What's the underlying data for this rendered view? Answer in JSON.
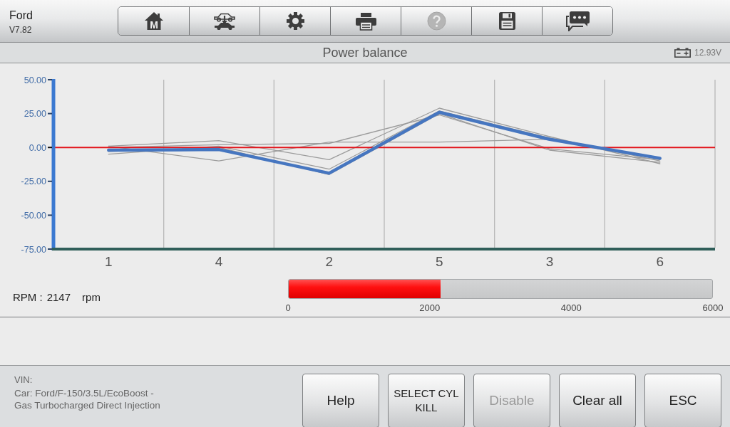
{
  "header": {
    "title": "Ford",
    "version": "V7.82"
  },
  "toolbar": [
    {
      "kind": "home",
      "letter": "M",
      "disabled": false
    },
    {
      "kind": "vehicle",
      "disabled": false
    },
    {
      "kind": "settings",
      "disabled": false
    },
    {
      "kind": "print",
      "disabled": false
    },
    {
      "kind": "help",
      "disabled": true
    },
    {
      "kind": "save",
      "disabled": false
    },
    {
      "kind": "messages",
      "disabled": false
    }
  ],
  "title_bar": {
    "title": "Power balance",
    "battery_voltage": "12.93V"
  },
  "graph": {
    "chart_data": {
      "type": "line",
      "categories": [
        "1",
        "4",
        "2",
        "5",
        "3",
        "6"
      ],
      "ylim": [
        -75,
        50
      ],
      "yticks": [
        {
          "value": 50,
          "label": "50.00"
        },
        {
          "value": 25,
          "label": "25.00"
        },
        {
          "value": 0,
          "label": "0.00"
        },
        {
          "value": -25,
          "label": "-25.00"
        },
        {
          "value": -50,
          "label": "-50.00"
        },
        {
          "value": -75,
          "label": "-75.00"
        }
      ],
      "series": [
        {
          "color": "#9c9c9c",
          "values": [
            -5,
            1,
            -16,
            27,
            7,
            -10
          ]
        },
        {
          "color": "#9c9c9c",
          "values": [
            1,
            5,
            -9,
            29,
            8,
            -12
          ]
        },
        {
          "color": "#9c9c9c",
          "values": [
            1,
            -10,
            4,
            4,
            6,
            -8
          ]
        },
        {
          "color": "#9c9c9c",
          "values": [
            0,
            2,
            3,
            24,
            -1,
            -9
          ]
        },
        {
          "color": "#9c9c9c",
          "values": [
            -3,
            0,
            -20,
            25,
            -2,
            -11
          ]
        },
        {
          "color": "#4676c0",
          "values": [
            -2,
            -1.5,
            -19,
            26,
            6,
            -8
          ]
        }
      ],
      "ref_lines": [
        {
          "axis": "y",
          "value": 0,
          "color": "#e3141b"
        }
      ]
    }
  },
  "rpm": {
    "label": "RPM :",
    "value": "2147",
    "unit": "rpm",
    "level": 0.358,
    "scale": [
      "0",
      "2000",
      "4000",
      "6000"
    ]
  },
  "vehicle_info": {
    "vin_label": "VIN:",
    "car": "Car: Ford/F-150/3.5L/EcoBoost - Gas Turbocharged Direct Injection"
  },
  "buttons": [
    {
      "label": "Help",
      "disabled": false
    },
    {
      "label": "SELECT CYL KILL",
      "disabled": false
    },
    {
      "label": "Disable",
      "disabled": true
    },
    {
      "label": "Clear all",
      "disabled": false
    },
    {
      "label": "ESC",
      "disabled": false
    }
  ]
}
